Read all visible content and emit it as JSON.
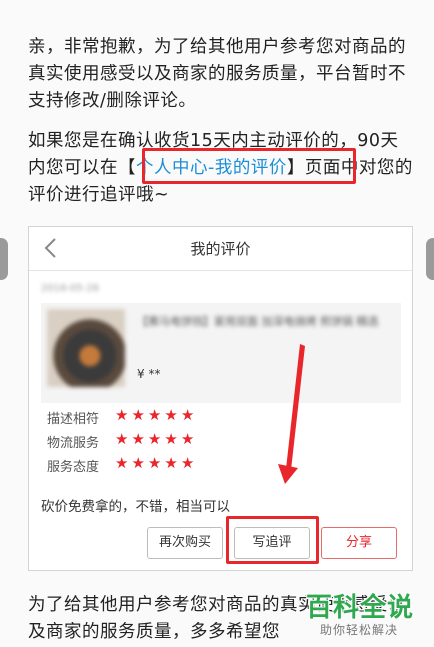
{
  "article": {
    "para1": "亲，非常抱歉，为了给其他用户参考您对商品的真实使用感受以及商家的服务质量，平台暂时不支持修改/删除评论。",
    "para2_before": "如果您是在确认收货15天内主动评价的，90天内您可以在【",
    "para2_link": "个人中心-我的评价",
    "para2_after": "】页面中对您的评价进行追评哦~",
    "para3": "为了给其他用户参考您对商品的真实使用感受以及商家的服务质量，多多希望您"
  },
  "screenshot": {
    "title": "我的评价",
    "date": "2016-05-26",
    "product_name": "【赛马电饼铛】家用双面 加深电烧烤 煎饼锅 精选",
    "price": "¥ **",
    "ratings": [
      {
        "label": "描述相符",
        "stars": 5
      },
      {
        "label": "物流服务",
        "stars": 5
      },
      {
        "label": "服务态度",
        "stars": 5
      }
    ],
    "comment": "砍价免费拿的，不错，相当可以",
    "buttons": {
      "rebuy": "再次购买",
      "follow_up": "写追评",
      "share": "分享"
    }
  },
  "watermark": {
    "main": "百科全说",
    "sub": "助你轻松解决"
  },
  "colors": {
    "highlight_red": "#e8262b",
    "link_blue": "#1a8fd6",
    "star_red": "#e8262b",
    "watermark_green": "#2fa84f"
  }
}
